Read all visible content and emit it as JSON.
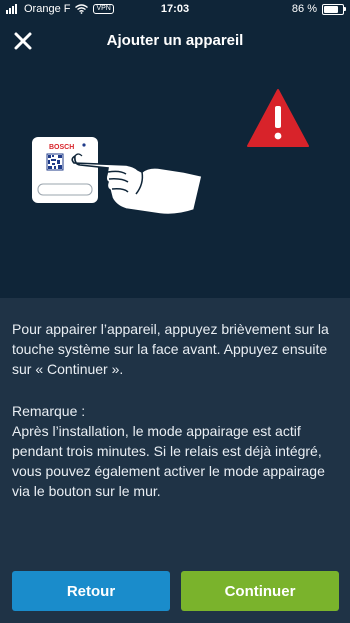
{
  "status_bar": {
    "carrier": "Orange F",
    "vpn": "VPN",
    "time": "17:03",
    "battery": "86 %",
    "battery_level": 0.86
  },
  "header": {
    "title": "Ajouter un appareil",
    "close_icon": "close-icon"
  },
  "illustration": {
    "brand": "BOSCH",
    "device_icon": "relay-device-icon",
    "hand_icon": "pointing-hand-icon",
    "warning_icon": "warning-triangle-icon"
  },
  "content": {
    "instructions": "Pour appairer l’appareil, appuyez brièvement sur la touche système sur la face avant. Appuyez ensuite sur « Continuer ».",
    "remark_title": "Remarque :",
    "remark_body": "Après l’installation, le mode appairage est actif pendant trois minutes. Si le relais est déjà intégré, vous pouvez également activer le mode appairage via le bouton sur le mur."
  },
  "buttons": {
    "back": "Retour",
    "continue": "Continuer"
  },
  "colors": {
    "header_bg": "#0f2538",
    "content_bg": "#1f3346",
    "back_button": "#1a8ccb",
    "continue_button": "#7ab32c",
    "warning": "#d8232a"
  }
}
